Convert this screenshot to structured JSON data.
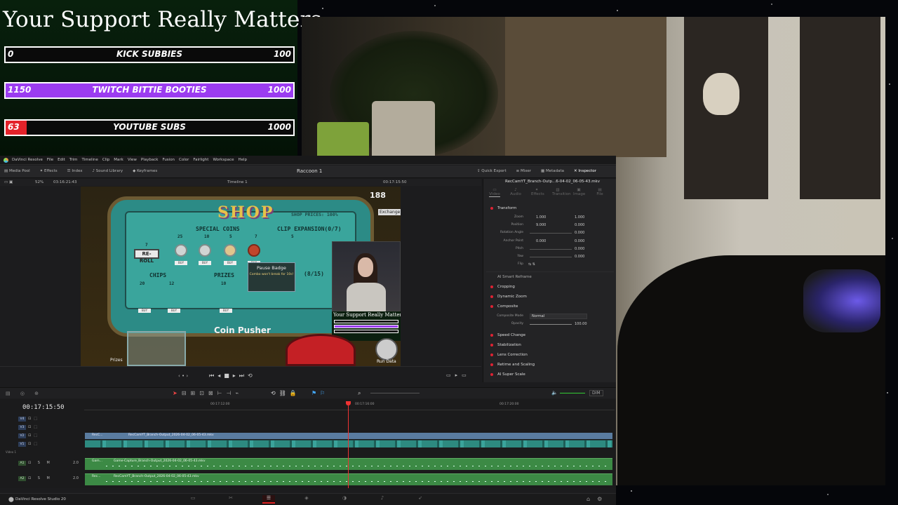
{
  "goals": {
    "title": "Your Support Really Matters",
    "bars": [
      {
        "current": "0",
        "label": "KICK SUBBIES",
        "max": "100",
        "progress": 0.0,
        "color": "#2bd92b"
      },
      {
        "current": "1150",
        "label": "TWITCH BITTIE BOOTIES",
        "max": "1000",
        "progress": 1.0,
        "color": "#9b3cf0"
      },
      {
        "current": "63",
        "label": "YOUTUBE SUBS",
        "max": "1000",
        "progress": 0.063,
        "color": "#e3222a"
      }
    ]
  },
  "resolve": {
    "menu": [
      "DaVinci Resolve",
      "File",
      "Edit",
      "Trim",
      "Timeline",
      "Clip",
      "Mark",
      "View",
      "Playback",
      "Fusion",
      "Color",
      "Fairlight",
      "Workspace",
      "Help"
    ],
    "tools_left": [
      "Media Pool",
      "Effects",
      "Index",
      "Sound Library",
      "Keyframes"
    ],
    "project_title": "Raccoon 1",
    "tools_right": [
      "Quick Export",
      "Mixer",
      "Metadata",
      "Inspector"
    ],
    "zoom": "52%",
    "viewer_timecode": "03:16:21:43",
    "timeline_name": "Timeline 1",
    "source_timecode": "00:17:15:50",
    "inspector": {
      "clip_name": "RecCamYT_Branch-Outp...6-04-02_06-05-43.mkv",
      "tabs": [
        "Video",
        "Audio",
        "Effects",
        "Transition",
        "Image",
        "File"
      ],
      "transform_label": "Transform",
      "props": {
        "zoom": {
          "label": "Zoom",
          "x": "1.000",
          "y": "1.000"
        },
        "position": {
          "label": "Position",
          "x": "9.000",
          "y": "0.000"
        },
        "rotation": {
          "label": "Rotation Angle",
          "value": "0.000"
        },
        "anchor": {
          "label": "Anchor Point",
          "x": "0.000",
          "y": "0.000"
        },
        "pitch": {
          "label": "Pitch",
          "value": "0.000"
        },
        "yaw": {
          "label": "Yaw",
          "value": "0.000"
        },
        "flip": {
          "label": "Flip"
        }
      },
      "ai_smart_reframe": "AI Smart Reframe",
      "sections": [
        "Cropping",
        "Dynamic Zoom",
        "Composite"
      ],
      "composite_mode_label": "Composite Mode",
      "composite_mode_value": "Normal",
      "opacity_label": "Opacity",
      "opacity_value": "100.00",
      "sections2": [
        "Speed Change",
        "Stabilization",
        "Lens Correction",
        "Retime and Scaling",
        "AI Super Scale"
      ]
    },
    "viewer": {
      "shop": "SHOP",
      "shop_prices": "SHOP PRICES: 100%",
      "special_coins": "SPECIAL COINS",
      "clip_expansion": "CLIP EXPANSION(0/7)",
      "reroll": "RE-ROLL",
      "chips": "CHIPS",
      "prizes": "PRIZES",
      "pause_badge": "Pause Badge",
      "pause_desc": "Combo won't break for 10s!",
      "count": "(8/15)",
      "coin_pusher": "Coin Pusher",
      "prizes_btn": "Prizes",
      "run_data": "Run Data",
      "coins": "188",
      "exchange": "Exchange",
      "prices": [
        "7",
        "25",
        "10",
        "5",
        "7",
        "5"
      ],
      "chip_prices": [
        "20",
        "12"
      ],
      "prize_price": "10",
      "buy": "BUY",
      "pip_title": "Your Support Really Matters"
    },
    "timeline": {
      "timecode": "00:17:15:50",
      "ruler": [
        "00:17:12:00",
        "00:17:16:00",
        "00:17:20:00"
      ],
      "video_tracks": [
        "V4",
        "V3",
        "V2",
        "V1"
      ],
      "audio_tracks": [
        "A1",
        "A2"
      ],
      "track_group": "Video 1",
      "clip_v2": "RecCamYT_Branch-Output_2026-04-02_06-05-43.mkv",
      "clip_v2_short": "RecC...",
      "clip_a1": "Game-Capture_Branch-Output_2026-04-02_06-05-43.mkv",
      "clip_a1_short": "Gam...",
      "clip_a2": "RecCamYT_Branch-Output_2026-04-02_06-05-43.mkv",
      "clip_a2_short": "Rec...",
      "audio_level": "2.0",
      "dim": "DIM"
    },
    "status_app": "DaVinci Resolve Studio 20"
  }
}
